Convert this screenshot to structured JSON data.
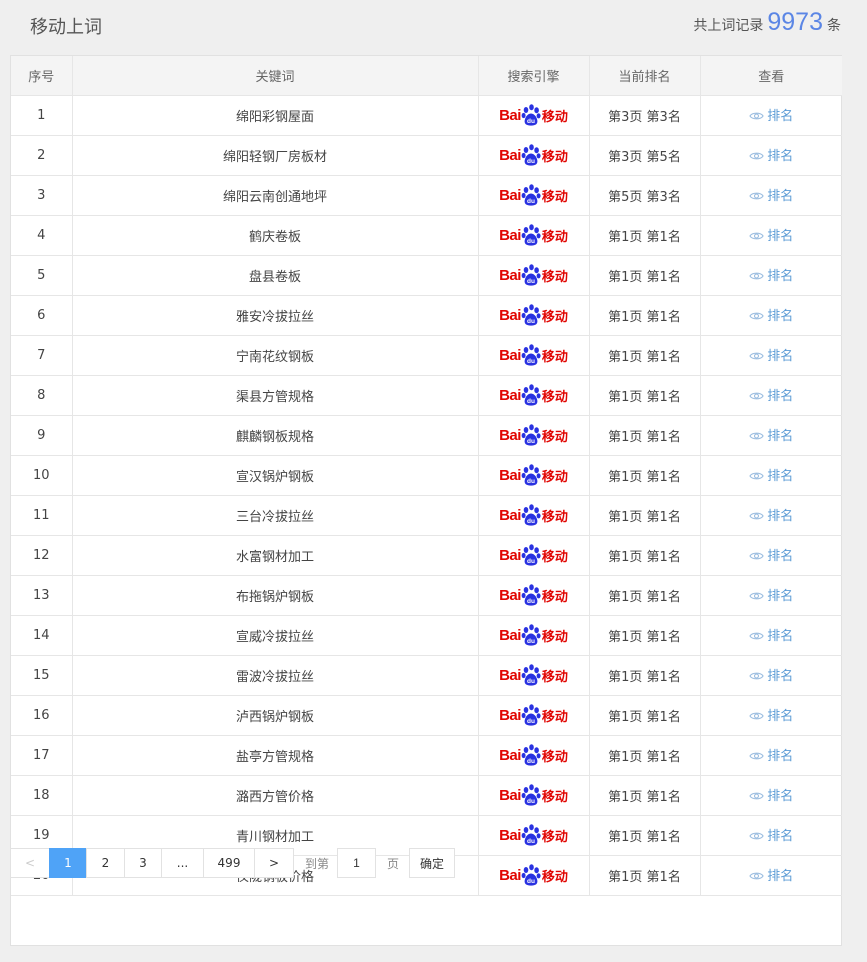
{
  "header": {
    "title": "移动上词",
    "total_prefix": "共上词记录",
    "total_count": "9973",
    "total_suffix": "条"
  },
  "table": {
    "columns": [
      "序号",
      "关键词",
      "搜索引擎",
      "当前排名",
      "查看"
    ],
    "engine": {
      "bai": "Bai",
      "du": "du",
      "mobile": "移动",
      "color": "#e10602"
    },
    "view_label": "排名",
    "rows": [
      {
        "idx": "1",
        "keyword": "绵阳彩钢屋面",
        "rank": "第3页 第3名"
      },
      {
        "idx": "2",
        "keyword": "绵阳轻钢厂房板材",
        "rank": "第3页 第5名"
      },
      {
        "idx": "3",
        "keyword": "绵阳云南创通地坪",
        "rank": "第5页 第3名"
      },
      {
        "idx": "4",
        "keyword": "鹤庆卷板",
        "rank": "第1页 第1名"
      },
      {
        "idx": "5",
        "keyword": "盘县卷板",
        "rank": "第1页 第1名"
      },
      {
        "idx": "6",
        "keyword": "雅安冷拔拉丝",
        "rank": "第1页 第1名"
      },
      {
        "idx": "7",
        "keyword": "宁南花纹钢板",
        "rank": "第1页 第1名"
      },
      {
        "idx": "8",
        "keyword": "渠县方管规格",
        "rank": "第1页 第1名"
      },
      {
        "idx": "9",
        "keyword": "麒麟钢板规格",
        "rank": "第1页 第1名"
      },
      {
        "idx": "10",
        "keyword": "宣汉锅炉钢板",
        "rank": "第1页 第1名"
      },
      {
        "idx": "11",
        "keyword": "三台冷拔拉丝",
        "rank": "第1页 第1名"
      },
      {
        "idx": "12",
        "keyword": "水富钢材加工",
        "rank": "第1页 第1名"
      },
      {
        "idx": "13",
        "keyword": "布拖锅炉钢板",
        "rank": "第1页 第1名"
      },
      {
        "idx": "14",
        "keyword": "宣威冷拔拉丝",
        "rank": "第1页 第1名"
      },
      {
        "idx": "15",
        "keyword": "雷波冷拔拉丝",
        "rank": "第1页 第1名"
      },
      {
        "idx": "16",
        "keyword": "泸西锅炉钢板",
        "rank": "第1页 第1名"
      },
      {
        "idx": "17",
        "keyword": "盐亭方管规格",
        "rank": "第1页 第1名"
      },
      {
        "idx": "18",
        "keyword": "潞西方管价格",
        "rank": "第1页 第1名"
      },
      {
        "idx": "19",
        "keyword": "青川钢材加工",
        "rank": "第1页 第1名"
      },
      {
        "idx": "20",
        "keyword": "仪陇钢板价格",
        "rank": "第1页 第1名"
      }
    ]
  },
  "pagination": {
    "prev": "<",
    "pages": [
      "1",
      "2",
      "3",
      "...",
      "499"
    ],
    "next": ">",
    "current": "1",
    "jump_label": "到第",
    "jump_value": "1",
    "page_label": "页",
    "confirm_label": "确定"
  }
}
